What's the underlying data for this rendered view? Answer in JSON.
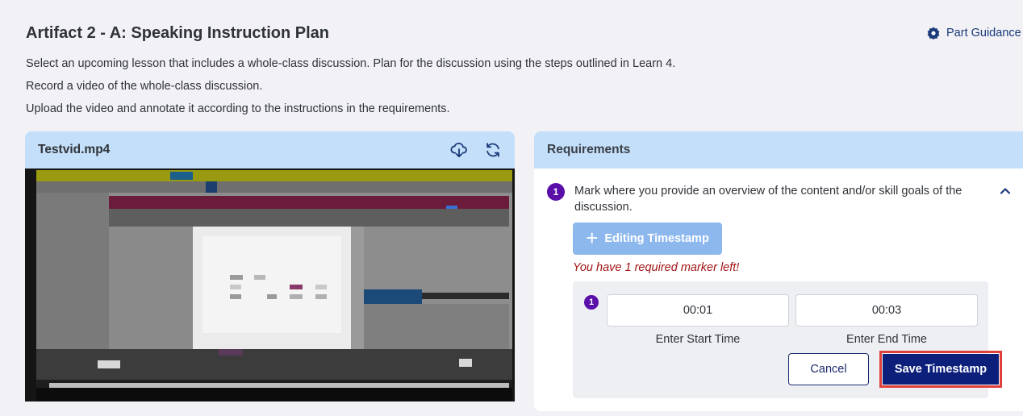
{
  "header": {
    "title": "Artifact 2 - A: Speaking Instruction Plan",
    "guidance_label": "Part Guidance",
    "guidance_icon": "gear-badge-icon"
  },
  "instructions": [
    "Select an upcoming lesson that includes a whole-class discussion. Plan for the discussion using the steps outlined in Learn 4.",
    "Record a video of the whole-class discussion.",
    "Upload the video and annotate it according to the instructions in the requirements."
  ],
  "video": {
    "filename": "Testvid.mp4",
    "download_icon": "cloud-download-icon",
    "refresh_icon": "refresh-icon"
  },
  "requirements": {
    "title": "Requirements",
    "items": [
      {
        "number": "1",
        "text": "Mark where you provide an overview of the content and/or skill goals of the discussion."
      }
    ],
    "edit_button_label": "Editing Timestamp",
    "warning": "You have 1 required marker left!",
    "timestamp": {
      "number": "1",
      "start_value": "00:01",
      "end_value": "00:03",
      "start_label": "Enter Start Time",
      "end_label": "Enter End Time",
      "cancel_label": "Cancel",
      "save_label": "Save Timestamp"
    }
  },
  "colors": {
    "accent": "#0c1f7a",
    "badge": "#5a0fa8",
    "panel_header": "#c4dff9",
    "warning": "#a31515",
    "highlight": "#e0403a"
  }
}
